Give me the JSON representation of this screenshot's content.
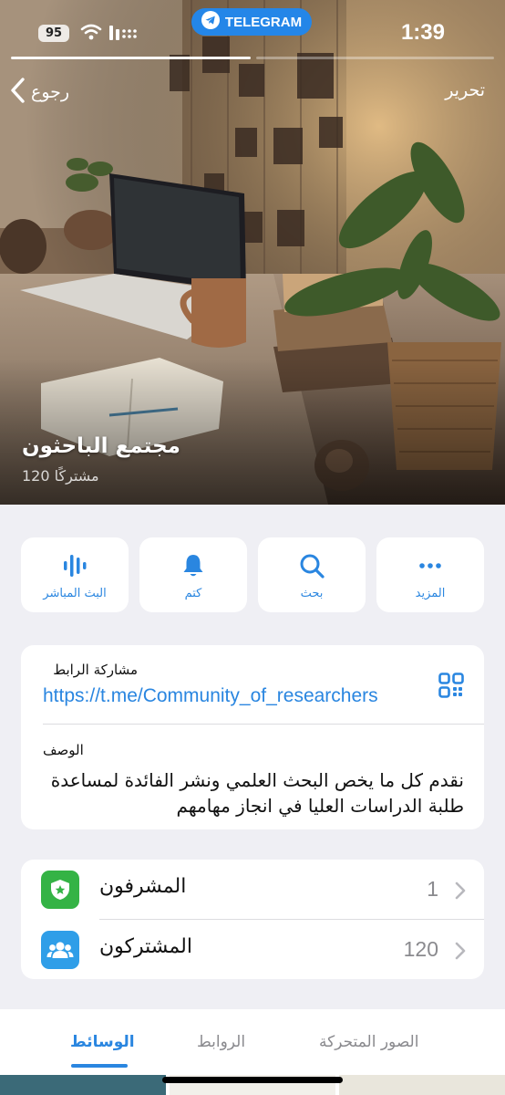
{
  "status_bar": {
    "battery": "95",
    "carrier_pill": "TELEGRAM",
    "time": "1:39"
  },
  "nav": {
    "back_label": "رجوع",
    "edit_label": "تحرير"
  },
  "channel": {
    "name": "مجتمع الباحثون",
    "subscribers": "120 مشتركًا"
  },
  "actions": [
    {
      "label": "البث المباشر",
      "icon": "live-stream-icon"
    },
    {
      "label": "كتم",
      "icon": "bell-icon"
    },
    {
      "label": "بحث",
      "icon": "search-icon"
    },
    {
      "label": "المزيد",
      "icon": "more-icon"
    }
  ],
  "info": {
    "link_label": "مشاركة الرابط",
    "link_value": "https://t.me/Community_of_researchers",
    "description_label": "الوصف",
    "description_text": "نقدم كل ما يخص البحث العلمي ونشر الفائدة لمساعدة طلبة الدراسات العليا في انجاز مهامهم"
  },
  "members": {
    "admins_label": "المشرفون",
    "admins_count": "1",
    "subscribers_label": "المشتركون",
    "subscribers_count": "120"
  },
  "tabs": [
    {
      "label": "الوسائط",
      "active": true
    },
    {
      "label": "الروابط",
      "active": false
    },
    {
      "label": "الصور المتحركة",
      "active": false
    }
  ],
  "colors": {
    "accent": "#2a86e0",
    "admins_tile": "#34b345",
    "subscribers_tile": "#2f9ee8",
    "telegram_pill": "#2486e8"
  }
}
